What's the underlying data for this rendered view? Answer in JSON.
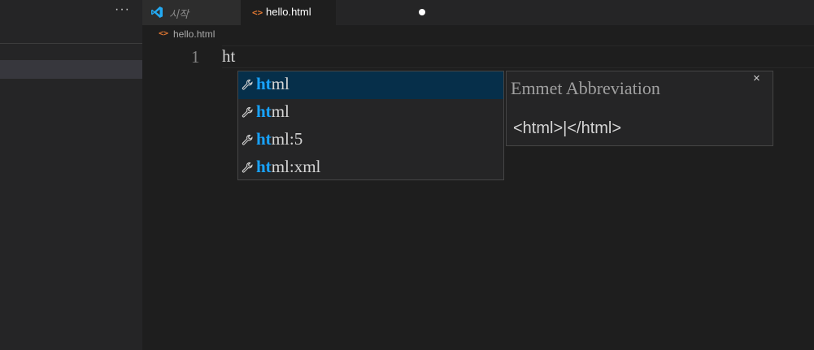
{
  "sidebar": {
    "more_actions_label": "···"
  },
  "tabs": [
    {
      "label": "시작",
      "icon": "vscode-logo-icon",
      "active": false
    },
    {
      "label": "hello.html",
      "icon": "html-file-icon",
      "active": true,
      "dirty": true
    }
  ],
  "breadcrumb": {
    "file": "hello.html",
    "icon": "html-file-icon"
  },
  "editor": {
    "line_number": "1",
    "line_text": "ht"
  },
  "suggest": {
    "items": [
      {
        "match": "ht",
        "rest": "ml",
        "icon": "wrench-icon",
        "focused": true
      },
      {
        "match": "ht",
        "rest": "ml",
        "icon": "wrench-icon",
        "focused": false
      },
      {
        "match": "ht",
        "rest": "ml:5",
        "icon": "wrench-icon",
        "focused": false
      },
      {
        "match": "ht",
        "rest": "ml:xml",
        "icon": "wrench-icon",
        "focused": false
      }
    ]
  },
  "details": {
    "title": "Emmet Abbreviation",
    "close_label": "×",
    "code": "<html>|</html>"
  },
  "colors": {
    "match_highlight": "#18a3ff",
    "focused_row": "#062f4a",
    "html_icon": "#e37933",
    "vscode_blue": "#23a9f2"
  }
}
